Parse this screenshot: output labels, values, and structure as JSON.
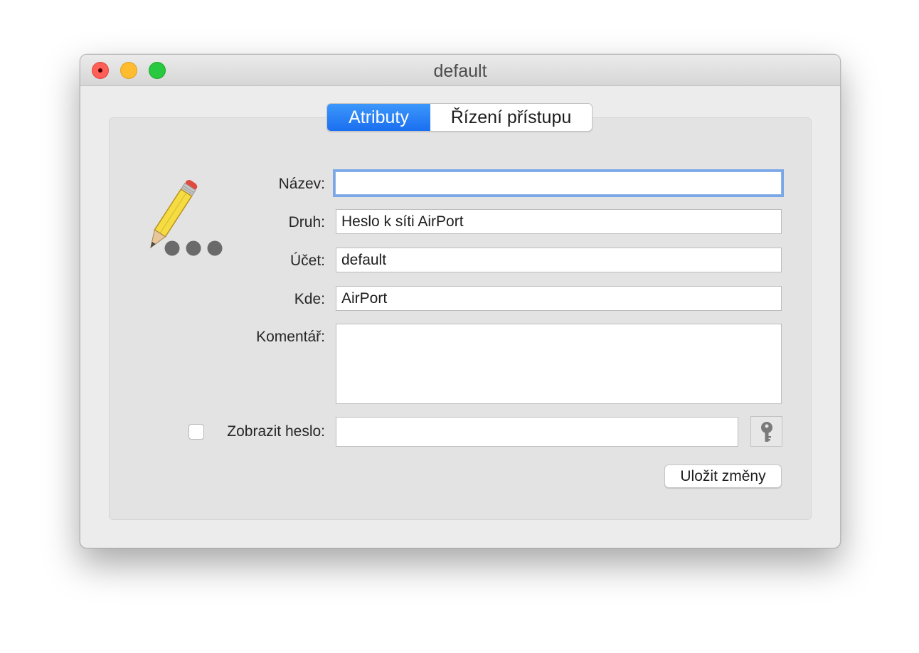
{
  "window": {
    "title": "default"
  },
  "tabs": [
    {
      "label": "Atributy",
      "active": true
    },
    {
      "label": "Řízení přístupu",
      "active": false
    }
  ],
  "icon": "pencil-password-icon",
  "form": {
    "name": {
      "label": "Název:",
      "value": ""
    },
    "kind": {
      "label": "Druh:",
      "value": "Heslo k síti AirPort"
    },
    "account": {
      "label": "Účet:",
      "value": "default"
    },
    "where": {
      "label": "Kde:",
      "value": "AirPort"
    },
    "comment": {
      "label": "Komentář:",
      "value": ""
    },
    "show_password": {
      "label": "Zobrazit heslo:",
      "checked": false,
      "value": ""
    }
  },
  "buttons": {
    "key_icon": "key-icon",
    "save_label": "Uložit změny"
  },
  "colors": {
    "accent": "#1a6ff0",
    "focus_ring": "#7aa7e8",
    "close": "#fe5f57",
    "minimize": "#febc2e",
    "zoom": "#28c840"
  }
}
